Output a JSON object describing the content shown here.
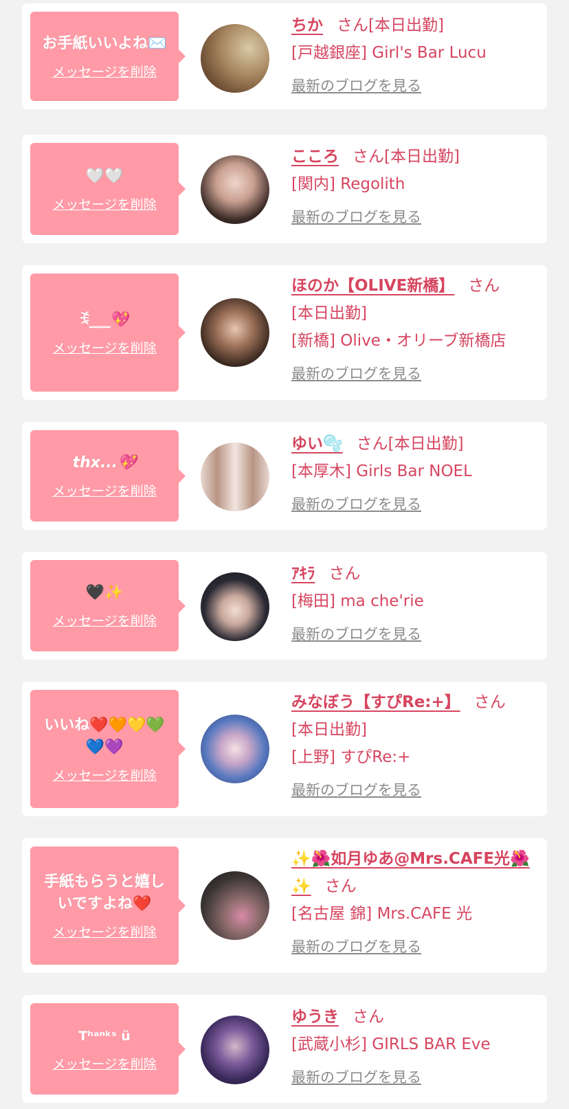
{
  "delete_label": "メッセージを削除",
  "blog_label": "最新のブログを見る",
  "honorific": "さん",
  "accent_color": "#d6455f",
  "bubble_color": "#ff9aa6",
  "items": [
    {
      "message": "お手紙いいよね✉️",
      "name": "ちか",
      "status": "[本日出勤]",
      "shop": "[戸越銀座] Girl's Bar Lucu"
    },
    {
      "message": "🤍🤍",
      "name": "こころ",
      "status": "[本日出勤]",
      "shop": "[関内] Regolith"
    },
    {
      "message": "ꉂ ̫ ̫ ̫ ̫💖",
      "name": "ほのか【OLIVE新橋】",
      "status": "[本日出勤]",
      "shop": "[新橋] Olive・オリーブ新橋店"
    },
    {
      "message": "thx...💖",
      "name": "ゆい🫧",
      "status": "[本日出勤]",
      "shop": "[本厚木] Girls Bar NOEL"
    },
    {
      "message": "🖤✨",
      "name": "ｱｷﾗ",
      "status": "",
      "shop": "[梅田] ma che'rie"
    },
    {
      "message": "いいね❤️🧡💛💚💙💜",
      "name": "みなぼう【すぴRe:+】",
      "status": "[本日出勤]",
      "shop": "[上野] すぴRe:+"
    },
    {
      "message": "手紙もらうと嬉しいですよね❤️",
      "name": "✨🌺如月ゆあ@Mrs.CAFE光🌺✨",
      "status": "",
      "shop": "[名古屋 錦] Mrs.CAFE 光"
    },
    {
      "message": "Tʰᵃⁿᵏˢ ü",
      "name": "ゆうき",
      "status": "",
      "shop": "[武蔵小杉] GIRLS BAR Eve"
    }
  ]
}
